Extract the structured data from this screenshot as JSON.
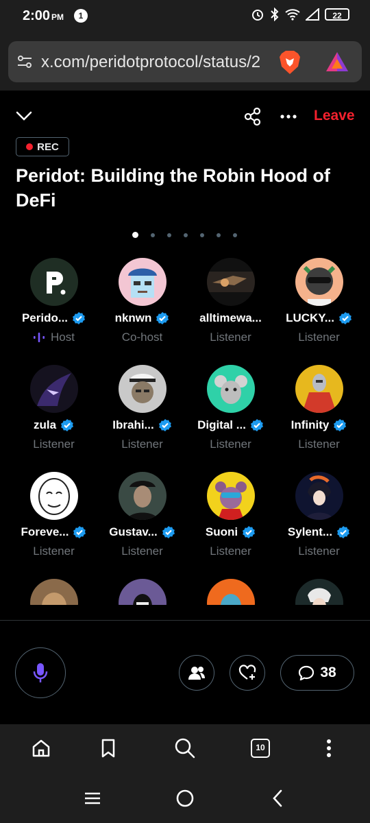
{
  "status_bar": {
    "time": "2:00",
    "ampm": "PM",
    "notification_count": "1",
    "battery": "22"
  },
  "browser": {
    "url": "x.com/peridotprotocol/status/2",
    "tab_count": "10"
  },
  "space": {
    "leave_label": "Leave",
    "rec_label": "REC",
    "title": "Peridot: Building the Robin Hood of DeFi",
    "page_count": 7,
    "active_page": 1,
    "participants": [
      {
        "name": "Perido...",
        "role": "Host",
        "verified": true
      },
      {
        "name": "nknwn",
        "role": "Co-host",
        "verified": true
      },
      {
        "name": "alltimewa...",
        "role": "Listener",
        "verified": false
      },
      {
        "name": "LUCKY...",
        "role": "Listener",
        "verified": true
      },
      {
        "name": "zula",
        "role": "Listener",
        "verified": true
      },
      {
        "name": "Ibrahi...",
        "role": "Listener",
        "verified": true
      },
      {
        "name": "Digital ...",
        "role": "Listener",
        "verified": true
      },
      {
        "name": "Infinity",
        "role": "Listener",
        "verified": true
      },
      {
        "name": "Foreve...",
        "role": "Listener",
        "verified": true
      },
      {
        "name": "Gustav...",
        "role": "Listener",
        "verified": true
      },
      {
        "name": "Suoni",
        "role": "Listener",
        "verified": true
      },
      {
        "name": "Sylent...",
        "role": "Listener",
        "verified": true
      }
    ],
    "comments_count": "38"
  },
  "icons": {
    "collapse": "chevron-down-icon",
    "share": "share-icon",
    "more": "more-icon",
    "mic": "microphone-icon",
    "people": "people-icon",
    "react": "heart-plus-icon",
    "comments": "comment-icon",
    "verified": "verified-badge-icon"
  },
  "colors": {
    "leave": "#f4212e",
    "verified": "#1d9bf0",
    "mic": "#7856ff",
    "host_accent": "#7856ff"
  }
}
